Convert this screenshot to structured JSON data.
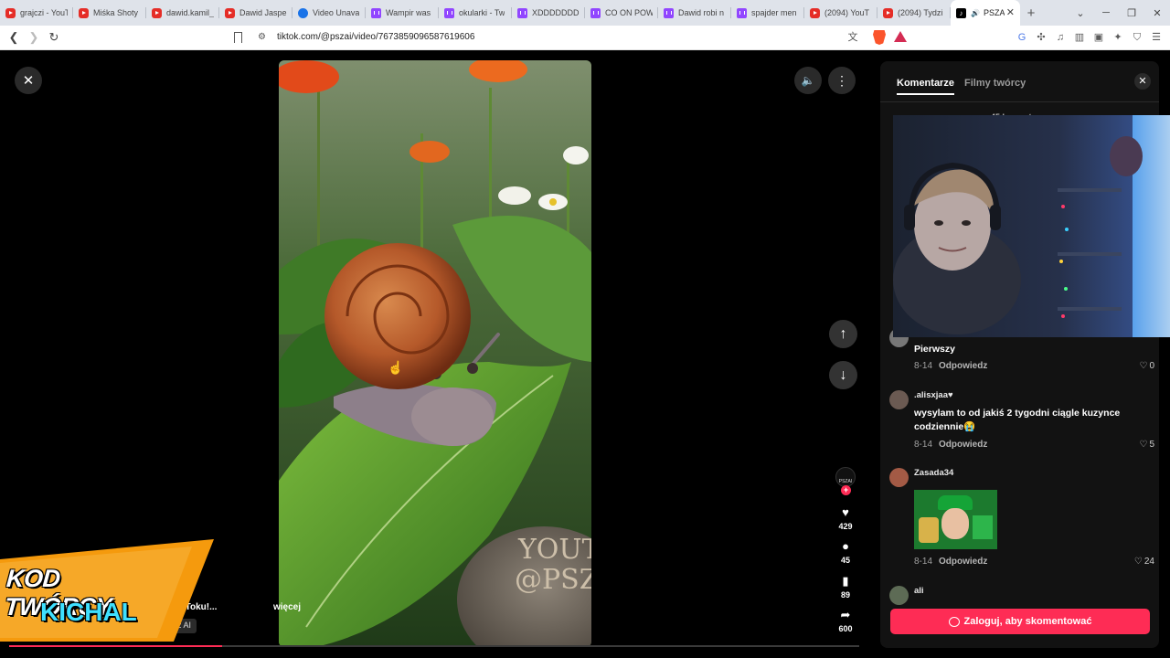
{
  "browser": {
    "tabs": [
      {
        "icon": "youtube",
        "title": "grajczi - YouT"
      },
      {
        "icon": "youtube",
        "title": "Miśka Shoty"
      },
      {
        "icon": "youtube",
        "title": "dawid.kamil_"
      },
      {
        "icon": "youtube",
        "title": "Dawid Jaspe"
      },
      {
        "icon": "globe",
        "title": "Video Unava"
      },
      {
        "icon": "twitch",
        "title": "Wampir was"
      },
      {
        "icon": "twitch",
        "title": "okularki - Tw"
      },
      {
        "icon": "twitch",
        "title": "XDDDDDDD"
      },
      {
        "icon": "twitch",
        "title": "CO ON POW"
      },
      {
        "icon": "twitch",
        "title": "Dawid robi n"
      },
      {
        "icon": "twitch",
        "title": "spajder men"
      },
      {
        "icon": "youtube",
        "title": "(2094) YouT"
      },
      {
        "icon": "youtube",
        "title": "(2094) Tydzi"
      },
      {
        "icon": "tiktok",
        "title": "PSZA"
      }
    ],
    "url": "tiktok.com/@pszai/video/7673859096587619606"
  },
  "video": {
    "stone_text_line1": "YOUTU",
    "stone_text_line2": "@PSZA",
    "progress_percent": 25
  },
  "rail": {
    "avatar_text": "PSZAI",
    "likes": "429",
    "comments": "45",
    "saves": "89",
    "shares": "600"
  },
  "caption": {
    "text": "a TikToku!...",
    "more": "więcej",
    "ai_label": "ą przez AI"
  },
  "banner": {
    "line1": "KOD TWÓRCY",
    "line2": "KICHAL",
    "color_orange": "#f59a0d",
    "color_cyan": "#3ee0ff"
  },
  "panel": {
    "tab_comments": "Komentarze",
    "tab_creator_videos": "Filmy twórcy",
    "comments_count": "45 komentarzy",
    "comments": [
      {
        "user": "",
        "text": "Pierwszy",
        "date": "8-14",
        "reply": "Odpowiedz",
        "likes": "0"
      },
      {
        "user": ".alisxjaa♥︎",
        "text": "wysylam to od jakiś 2 tygodni ciągle kuzyncе codziennie😭",
        "date": "8-14",
        "reply": "Odpowiedz",
        "likes": "5"
      },
      {
        "user": "Zasada34",
        "text": "",
        "date": "8-14",
        "reply": "Odpowiedz",
        "likes": "24"
      },
      {
        "user": "ali",
        "text": "",
        "date": "",
        "reply": "",
        "likes": ""
      }
    ],
    "login_button": "Zaloguj, aby skomentować"
  },
  "colors": {
    "accent": "#fe2c55",
    "panel_bg": "#121212"
  }
}
